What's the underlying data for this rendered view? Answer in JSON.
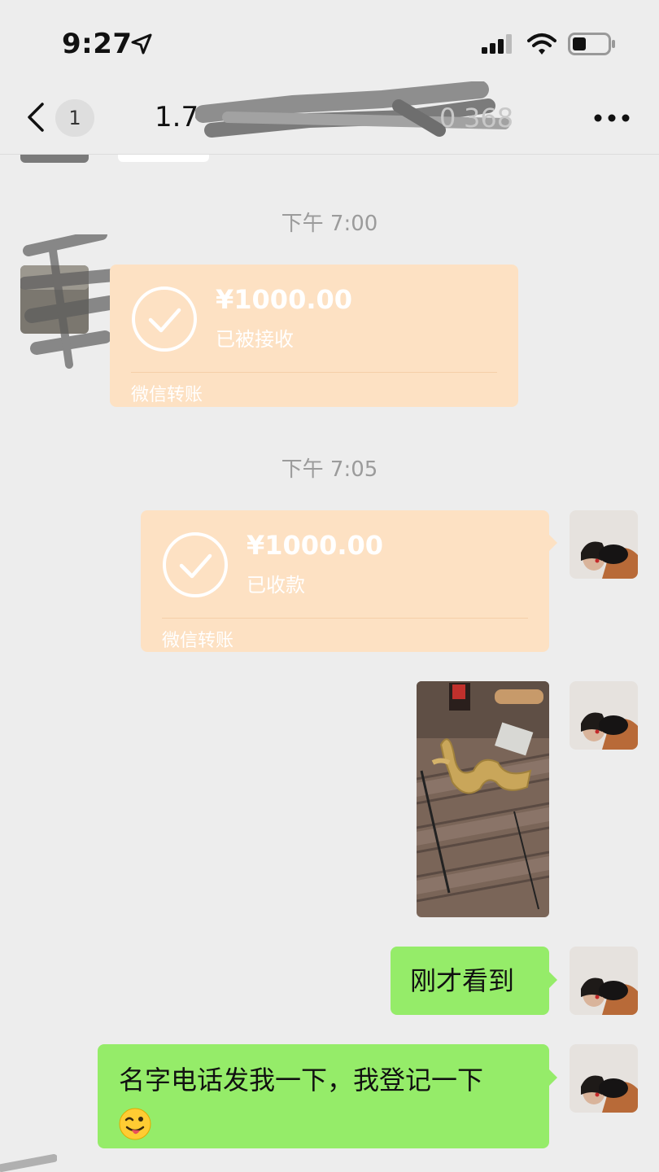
{
  "status_bar": {
    "time": "9:27"
  },
  "header": {
    "unread_count": "1",
    "title_visible": "1.7",
    "more_label": "more-options"
  },
  "messages": [
    {
      "type": "timestamp",
      "text": "下午 7:00"
    },
    {
      "type": "transfer",
      "direction": "incoming",
      "amount": "¥1000.00",
      "status": "已被接收",
      "footer": "微信转账"
    },
    {
      "type": "timestamp",
      "text": "下午 7:05"
    },
    {
      "type": "transfer",
      "direction": "outgoing",
      "amount": "¥1000.00",
      "status": "已收款",
      "footer": "微信转账"
    },
    {
      "type": "image",
      "direction": "outgoing"
    },
    {
      "type": "text",
      "direction": "outgoing",
      "text": "刚才看到"
    },
    {
      "type": "text",
      "direction": "outgoing",
      "text": "名字电话发我一下，我登记一下",
      "emoji": "winking-face-with-tongue-icon"
    }
  ],
  "colors": {
    "background": "#ededed",
    "transfer_bubble": "#fde1c3",
    "outgoing_bubble": "#95ec69"
  }
}
